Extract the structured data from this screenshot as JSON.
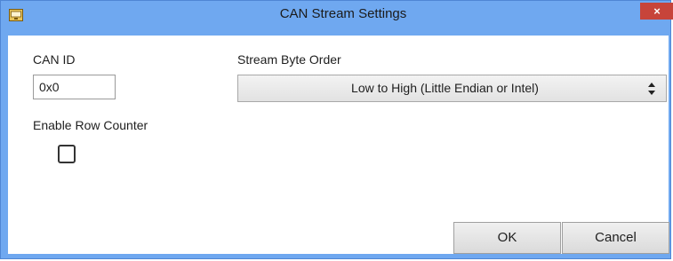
{
  "window": {
    "title": "CAN Stream Settings",
    "close_label": "×"
  },
  "fields": {
    "can_id_label": "CAN ID",
    "can_id_value": "0x0",
    "byte_order_label": "Stream Byte Order",
    "byte_order_value": "Low to High (Little Endian or Intel)",
    "row_counter_label": "Enable Row Counter",
    "row_counter_checked": false
  },
  "buttons": {
    "ok_label": "OK",
    "cancel_label": "Cancel"
  },
  "icons": {
    "app": "app-window-icon",
    "close": "close-icon",
    "select_arrows": "updown-arrows-icon"
  },
  "colors": {
    "titlebar": "#6fa8f0",
    "close_button": "#c7443a"
  }
}
